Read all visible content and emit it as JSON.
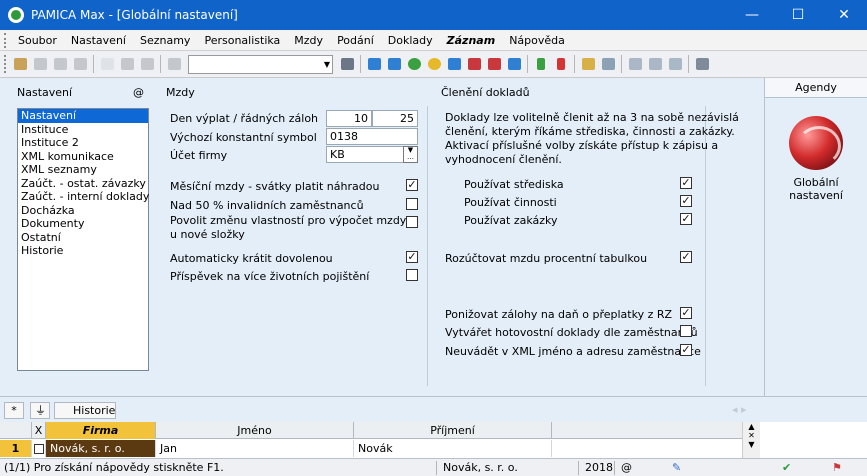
{
  "window": {
    "title": "PAMICA Max - [Globální nastavení]",
    "minimize_glyph": "—",
    "maximize_glyph": "☐",
    "close_glyph": "✕"
  },
  "menu": [
    "Soubor",
    "Nastavení",
    "Seznamy",
    "Personalistika",
    "Mzdy",
    "Podání",
    "Doklady",
    "Záznam",
    "Nápověda"
  ],
  "nastaveni": {
    "title": "Nastavení",
    "at_symbol": "@",
    "items": [
      "Nastavení",
      "Instituce",
      "Instituce 2",
      "XML komunikace",
      "XML seznamy",
      "Zaúčt. - ostat. závazky",
      "Zaúčt. - interní doklady",
      "Docházka",
      "Dokumenty",
      "Ostatní",
      "Historie"
    ],
    "selected_index": 0
  },
  "mzdy": {
    "title": "Mzdy",
    "den_label": "Den výplat / řádných záloh",
    "den_value1": "10",
    "den_value2": "25",
    "symbol_label": "Výchozí konstantní symbol",
    "symbol_value": "0138",
    "ucet_label": "Účet firmy",
    "ucet_value": "KB",
    "checks": [
      {
        "label": "Měsíční mzdy - svátky platit náhradou",
        "checked": true
      },
      {
        "label": "Nad 50 % invalidních zaměstnanců",
        "checked": false
      },
      {
        "label": "Povolit změnu vlastností pro výpočet mzdy",
        "label2": "u nové složky",
        "checked": false
      },
      {
        "label": "Automaticky krátit dovolenou",
        "checked": true
      },
      {
        "label": "Příspěvek na více životních pojištění",
        "checked": false
      }
    ]
  },
  "cleneni": {
    "title": "Členění dokladů",
    "description": [
      "Doklady lze volitelně členit až na 3 na sobě nezávislá",
      "členění, kterým říkáme střediska, činnosti a zakázky.",
      "Aktivací příslušné volby získáte přístup k zápisu a",
      "vyhodnocení členění."
    ],
    "checks": [
      {
        "label": "Používat střediska",
        "checked": true
      },
      {
        "label": "Používat činnosti",
        "checked": true
      },
      {
        "label": "Používat zakázky",
        "checked": true
      }
    ],
    "rozuctovat": {
      "label": "Rozúčtovat mzdu procentní tabulkou",
      "checked": true
    },
    "bottom_checks": [
      {
        "label": "Ponižovat zálohy na daň o přeplatky z RZ",
        "checked": true
      },
      {
        "label": "Vytvářet hotovostní doklady dle zaměstnanců",
        "checked": false
      },
      {
        "label": "Neuvádět v XML jméno a adresu zaměstnance",
        "checked": true
      }
    ]
  },
  "agenda": {
    "header": "Agendy",
    "item_label": "Globální nastavení"
  },
  "bottom": {
    "tab_star": "*",
    "tab_history": "Historie",
    "columns": {
      "x": "X",
      "firma": "Firma",
      "jmeno": "Jméno",
      "prijmeni": "Příjmení"
    },
    "row": {
      "num": "1",
      "firma": "Novák, s. r. o.",
      "jmeno": "Jan",
      "prijmeni": "Novák"
    }
  },
  "status": {
    "help": "(1/1) Pro získání nápovědy stiskněte F1.",
    "firm": "Novák, s. r. o.",
    "year": "2018",
    "at": "@"
  },
  "colors": {
    "titlebar": "#0f63c9",
    "selection": "#0e68d6",
    "panel": "#e4eef8",
    "grid_active": "#f1c23a",
    "firm_cell": "#5b3a12"
  }
}
